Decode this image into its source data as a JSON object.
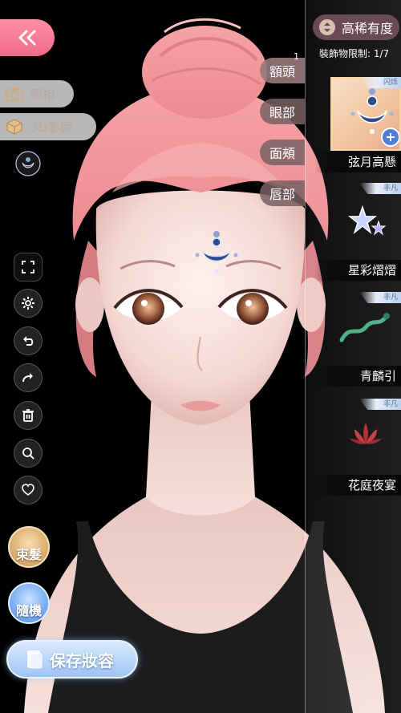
{
  "toolbar": {
    "photo_label": "照相",
    "studio_label": "3D影棚"
  },
  "categories": [
    {
      "label": "額頭",
      "count": "1"
    },
    {
      "label": "眼部"
    },
    {
      "label": "面頰"
    },
    {
      "label": "唇部"
    }
  ],
  "sort": {
    "label": "高稀有度"
  },
  "limit": {
    "text": "裝飾物限制: 1/7"
  },
  "items": [
    {
      "name": "弦月高懸",
      "tag": "闪烁",
      "selected": true
    },
    {
      "name": "星彩熠熠",
      "tag": "非凡"
    },
    {
      "name": "青麟引",
      "tag": "非凡"
    },
    {
      "name": "花庭夜宴",
      "tag": "非凡"
    }
  ],
  "actions": {
    "tie_hair": "束髮",
    "random": "隨機",
    "save": "保存妝容"
  },
  "icons": {
    "back": "double-chevron-left-icon",
    "camera": "camera-icon",
    "cube": "cube-icon",
    "fullscreen": "fullscreen-icon",
    "settings": "gear-icon",
    "undo": "undo-icon",
    "redo": "redo-icon",
    "delete": "trash-icon",
    "zoom": "magnifier-icon",
    "favorite": "heart-icon"
  },
  "colors": {
    "accent_pink": "#f06a86",
    "tab_bg": "#7a5f64",
    "sort_bg": "#6a4a54",
    "save_blue": "#9ec4f2"
  }
}
